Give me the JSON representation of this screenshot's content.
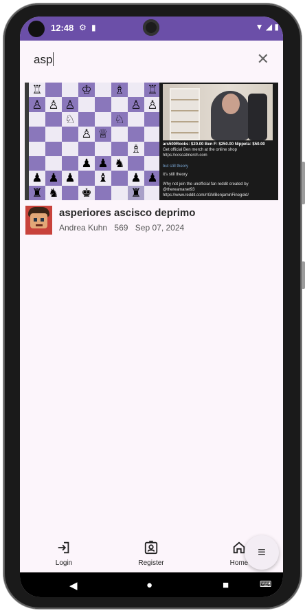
{
  "status": {
    "time": "12:48",
    "left_icons": [
      "gear-icon",
      "sim-card-icon"
    ],
    "right_icons": [
      "wifi-icon",
      "signal-icon",
      "battery-icon"
    ]
  },
  "search": {
    "query": "asp",
    "clear_icon": "close-icon"
  },
  "results": [
    {
      "title": "asperiores ascisco deprimo",
      "author": "Andrea Kuhn",
      "views": "569",
      "date": "Sep 07, 2024",
      "thumbnail_chat": [
        "ars500Rooks: $20.00   Ben F: $250.00   Nippeta: $50.00",
        "Get official Ben merch at the online shop https://ccscatmerch.com",
        "but still theory",
        "it's still theory",
        "Why not join the unofficial fan reddit created by @thereamanet93",
        "https://www.reddit.com/r/GMBenjaminFinegold/"
      ]
    }
  ],
  "bottom_nav": [
    {
      "label": "Login",
      "icon": "login-icon"
    },
    {
      "label": "Register",
      "icon": "register-icon"
    },
    {
      "label": "Home",
      "icon": "home-icon"
    }
  ],
  "fab": {
    "icon": "menu-icon"
  },
  "system_nav": [
    "back-icon",
    "home-circle-icon",
    "recents-icon",
    "keyboard-icon"
  ],
  "colors": {
    "status_bar": "#6b4fa8",
    "background": "#fcf5fb",
    "board_dark": "#8a77bb",
    "board_light": "#eeeaf4"
  }
}
